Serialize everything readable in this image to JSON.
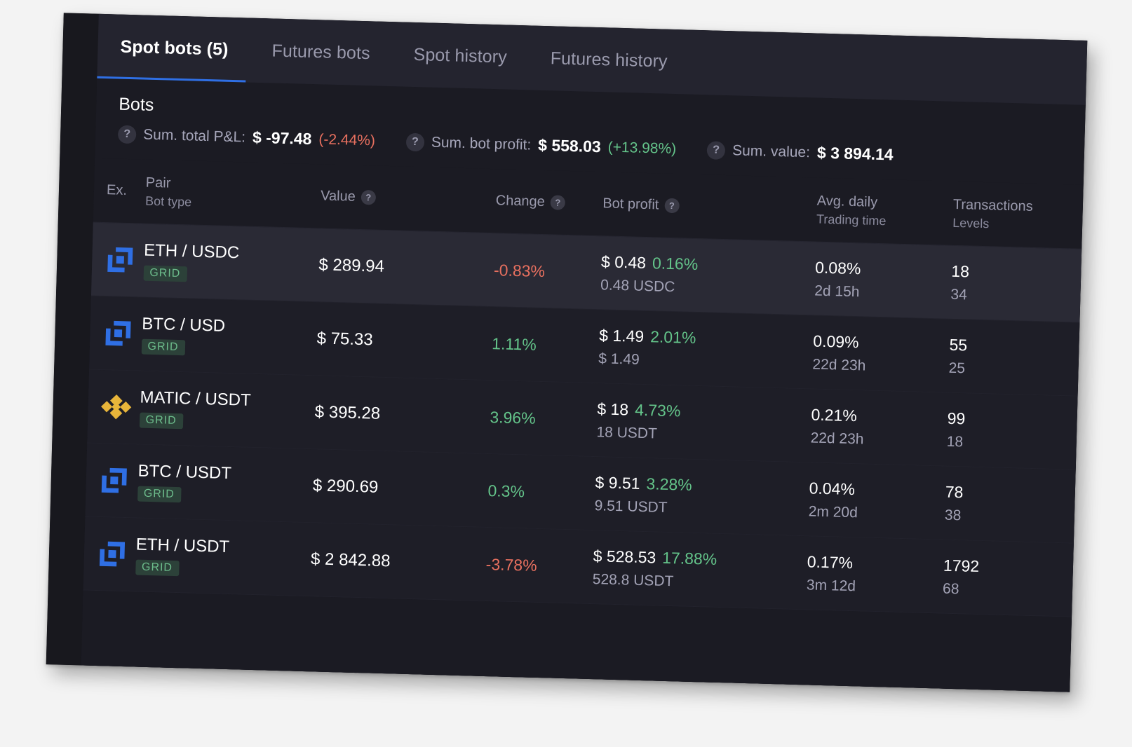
{
  "tabs": [
    {
      "label": "Spot bots (5)",
      "active": true
    },
    {
      "label": "Futures bots",
      "active": false
    },
    {
      "label": "Spot history",
      "active": false
    },
    {
      "label": "Futures history",
      "active": false
    }
  ],
  "section": {
    "title": "Bots"
  },
  "summary": [
    {
      "help": "?",
      "label": "Sum. total P&L:",
      "value": "$ -97.48",
      "pct": "(-2.44%)",
      "pct_sign": "negative"
    },
    {
      "help": "?",
      "label": "Sum. bot profit:",
      "value": "$ 558.03",
      "pct": "(+13.98%)",
      "pct_sign": "positive"
    },
    {
      "help": "?",
      "label": "Sum. value:",
      "value": "$ 3 894.14",
      "pct": "",
      "pct_sign": "none"
    }
  ],
  "table": {
    "headers": {
      "ex": "Ex.",
      "pair": "Pair",
      "pair_sub": "Bot type",
      "value": "Value",
      "value_help": "?",
      "change": "Change",
      "change_help": "?",
      "bot_profit": "Bot profit",
      "bot_profit_help": "?",
      "avg_daily": "Avg. daily",
      "avg_daily_sub": "Trading time",
      "transactions": "Transactions",
      "transactions_sub": "Levels"
    },
    "rows": [
      {
        "exchange_icon": "kraken-icon",
        "pair": "ETH / USDC",
        "bot_type": "GRID",
        "value": "$ 289.94",
        "change": "-0.83%",
        "change_sign": "negative",
        "bot_profit": "$ 0.48",
        "bot_profit_pct": "0.16%",
        "bot_profit_pct_sign": "positive",
        "bot_profit_sub": "0.48 USDC",
        "avg_daily": "0.08%",
        "trading_time": "2d 15h",
        "transactions": "18",
        "levels": "34",
        "highlight": true
      },
      {
        "exchange_icon": "kraken-icon",
        "pair": "BTC / USD",
        "bot_type": "GRID",
        "value": "$ 75.33",
        "change": "1.11%",
        "change_sign": "positive",
        "bot_profit": "$ 1.49",
        "bot_profit_pct": "2.01%",
        "bot_profit_pct_sign": "positive",
        "bot_profit_sub": "$ 1.49",
        "avg_daily": "0.09%",
        "trading_time": "22d 23h",
        "transactions": "55",
        "levels": "25",
        "highlight": false
      },
      {
        "exchange_icon": "binance-icon",
        "pair": "MATIC / USDT",
        "bot_type": "GRID",
        "value": "$ 395.28",
        "change": "3.96%",
        "change_sign": "positive",
        "bot_profit": "$ 18",
        "bot_profit_pct": "4.73%",
        "bot_profit_pct_sign": "positive",
        "bot_profit_sub": "18 USDT",
        "avg_daily": "0.21%",
        "trading_time": "22d 23h",
        "transactions": "99",
        "levels": "18",
        "highlight": false
      },
      {
        "exchange_icon": "kraken-icon",
        "pair": "BTC / USDT",
        "bot_type": "GRID",
        "value": "$ 290.69",
        "change": "0.3%",
        "change_sign": "positive",
        "bot_profit": "$ 9.51",
        "bot_profit_pct": "3.28%",
        "bot_profit_pct_sign": "positive",
        "bot_profit_sub": "9.51 USDT",
        "avg_daily": "0.04%",
        "trading_time": "2m 20d",
        "transactions": "78",
        "levels": "38",
        "highlight": false
      },
      {
        "exchange_icon": "kraken-icon",
        "pair": "ETH / USDT",
        "bot_type": "GRID",
        "value": "$ 2 842.88",
        "change": "-3.78%",
        "change_sign": "negative",
        "bot_profit": "$ 528.53",
        "bot_profit_pct": "17.88%",
        "bot_profit_pct_sign": "positive",
        "bot_profit_sub": "528.8 USDT",
        "avg_daily": "0.17%",
        "trading_time": "3m 12d",
        "transactions": "1792",
        "levels": "68",
        "highlight": false
      }
    ]
  },
  "colors": {
    "accent": "#2f6fe4",
    "positive": "#64c48a",
    "negative": "#e8705f",
    "badge_text": "#6dbd8c",
    "badge_bg": "#2c4139",
    "panel_bg": "#1b1b23",
    "tabbar_bg": "#24242f",
    "row_highlight": "#2a2a35",
    "kraken_blue": "#2f6fe4",
    "binance_gold": "#e8b53a"
  }
}
